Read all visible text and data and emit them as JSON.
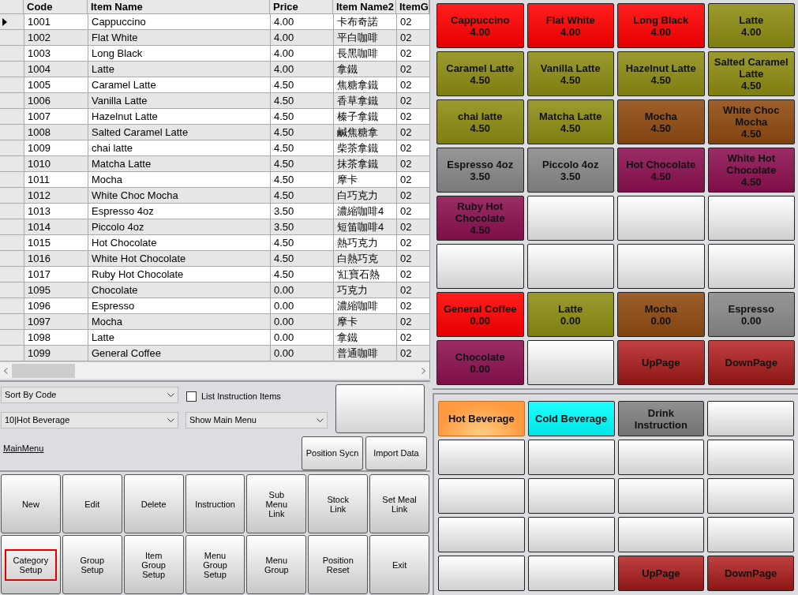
{
  "table": {
    "columns": [
      "Code",
      "Item Name",
      "Price",
      "Item Name2",
      "ItemG"
    ],
    "rows": [
      {
        "selected": true,
        "cells": [
          "1001",
          "Cappuccino",
          "4.00",
          "卡布奇諾",
          "02"
        ]
      },
      {
        "selected": false,
        "cells": [
          "1002",
          "Flat White",
          "4.00",
          "平白咖啡",
          "02"
        ]
      },
      {
        "selected": false,
        "cells": [
          "1003",
          "Long Black",
          "4.00",
          "長黑咖啡",
          "02"
        ]
      },
      {
        "selected": false,
        "cells": [
          "1004",
          "Latte",
          "4.00",
          "拿鐵",
          "02"
        ]
      },
      {
        "selected": false,
        "cells": [
          "1005",
          "Caramel Latte",
          "4.50",
          "焦糖拿鐵",
          "02"
        ]
      },
      {
        "selected": false,
        "cells": [
          "1006",
          "Vanilla Latte",
          "4.50",
          "香草拿鐵",
          "02"
        ]
      },
      {
        "selected": false,
        "cells": [
          "1007",
          "Hazelnut Latte",
          "4.50",
          "榛子拿鐵",
          "02"
        ]
      },
      {
        "selected": false,
        "cells": [
          "1008",
          "Salted Caramel Latte",
          "4.50",
          "鹹焦糖拿",
          "02"
        ]
      },
      {
        "selected": false,
        "cells": [
          "1009",
          "chai latte",
          "4.50",
          "柴茶拿鐵",
          "02"
        ]
      },
      {
        "selected": false,
        "cells": [
          "1010",
          "Matcha Latte",
          "4.50",
          "抹茶拿鐵",
          "02"
        ]
      },
      {
        "selected": false,
        "cells": [
          "1011",
          "Mocha",
          "4.50",
          "摩卡",
          "02"
        ]
      },
      {
        "selected": false,
        "cells": [
          "1012",
          "White Choc Mocha",
          "4.50",
          "白巧克力",
          "02"
        ]
      },
      {
        "selected": false,
        "cells": [
          "1013",
          "Espresso 4oz",
          "3.50",
          "濃縮咖啡4",
          "02"
        ]
      },
      {
        "selected": false,
        "cells": [
          "1014",
          "Piccolo 4oz",
          "3.50",
          "短笛咖啡4",
          "02"
        ]
      },
      {
        "selected": false,
        "cells": [
          "1015",
          "Hot Chocolate",
          "4.50",
          "熱巧克力",
          "02"
        ]
      },
      {
        "selected": false,
        "cells": [
          "1016",
          "White Hot Chocolate",
          "4.50",
          "白熱巧克",
          "02"
        ]
      },
      {
        "selected": false,
        "cells": [
          "1017",
          "Ruby Hot Chocolate",
          "4.50",
          "'紅寶石熱",
          "02"
        ]
      },
      {
        "selected": false,
        "cells": [
          "1095",
          "Chocolate",
          "0.00",
          "巧克力",
          "02"
        ]
      },
      {
        "selected": false,
        "cells": [
          "1096",
          "Espresso",
          "0.00",
          "濃縮咖啡",
          "02"
        ]
      },
      {
        "selected": false,
        "cells": [
          "1097",
          "Mocha",
          "0.00",
          "摩卡",
          "02"
        ]
      },
      {
        "selected": false,
        "cells": [
          "1098",
          "Latte",
          "0.00",
          "拿鐵",
          "02"
        ]
      },
      {
        "selected": false,
        "cells": [
          "1099",
          "General Coffee",
          "0.00",
          "普通咖啡",
          "02"
        ]
      }
    ]
  },
  "controls": {
    "sort_dropdown": "Sort By Code",
    "category_dropdown": "10|Hot Beverage",
    "list_instruction_items": {
      "label": "List Instruction Items",
      "checked": false
    },
    "menu_dropdown": "Show Main Menu",
    "link": "MainMenu",
    "buttons": [
      "Position Sycn",
      "Import Data"
    ]
  },
  "actions": [
    {
      "label": "New",
      "highlighted": false
    },
    {
      "label": "Edit",
      "highlighted": false
    },
    {
      "label": "Delete",
      "highlighted": false
    },
    {
      "label": "Instruction",
      "highlighted": false
    },
    {
      "label": "Sub Menu Link",
      "highlighted": false
    },
    {
      "label": "Stock Link",
      "highlighted": false
    },
    {
      "label": "Set Meal Link",
      "highlighted": false
    },
    {
      "label": "Category Setup",
      "highlighted": true
    },
    {
      "label": "Group Setup",
      "highlighted": false
    },
    {
      "label": "Item Group Setup",
      "highlighted": false
    },
    {
      "label": "Menu Group Setup",
      "highlighted": false
    },
    {
      "label": "Menu Group",
      "highlighted": false
    },
    {
      "label": "Position Reset",
      "highlighted": false
    },
    {
      "label": "Exit",
      "highlighted": false
    }
  ],
  "menu_buttons": [
    {
      "kind": "item",
      "label": "Cappuccino",
      "price": "4.00",
      "color": "#ff0000"
    },
    {
      "kind": "item",
      "label": "Flat White",
      "price": "4.00",
      "color": "#ff0000"
    },
    {
      "kind": "item",
      "label": "Long Black",
      "price": "4.00",
      "color": "#ff0000"
    },
    {
      "kind": "item",
      "label": "Latte",
      "price": "4.00",
      "color": "#8c8c12"
    },
    {
      "kind": "item",
      "label": "Caramel Latte",
      "price": "4.50",
      "color": "#8c8c12"
    },
    {
      "kind": "item",
      "label": "Vanilla Latte",
      "price": "4.50",
      "color": "#8c8c12"
    },
    {
      "kind": "item",
      "label": "Hazelnut Latte",
      "price": "4.50",
      "color": "#8c8c12"
    },
    {
      "kind": "item",
      "label": "Salted Caramel Latte",
      "price": "4.50",
      "color": "#8c8c12"
    },
    {
      "kind": "item",
      "label": "chai latte",
      "price": "4.50",
      "color": "#8c8c12"
    },
    {
      "kind": "item",
      "label": "Matcha Latte",
      "price": "4.50",
      "color": "#8c8c12"
    },
    {
      "kind": "item",
      "label": "Mocha",
      "price": "4.50",
      "color": "#8f4a10"
    },
    {
      "kind": "item",
      "label": "White Choc Mocha",
      "price": "4.50",
      "color": "#8f4a10"
    },
    {
      "kind": "item",
      "label": "Espresso 4oz",
      "price": "3.50",
      "color": "#888888"
    },
    {
      "kind": "item",
      "label": "Piccolo 4oz",
      "price": "3.50",
      "color": "#888888"
    },
    {
      "kind": "item",
      "label": "Hot Chocolate",
      "price": "4.50",
      "color": "#8c1050"
    },
    {
      "kind": "item",
      "label": "White Hot Chocolate",
      "price": "4.50",
      "color": "#8c1050"
    },
    {
      "kind": "item",
      "label": "Ruby Hot Chocolate",
      "price": "4.50",
      "color": "#8c1050"
    },
    {
      "kind": "empty"
    },
    {
      "kind": "empty"
    },
    {
      "kind": "empty"
    },
    {
      "kind": "empty"
    },
    {
      "kind": "empty"
    },
    {
      "kind": "empty"
    },
    {
      "kind": "empty"
    },
    {
      "kind": "item",
      "label": "General Coffee",
      "price": "0.00",
      "color": "#ff0000"
    },
    {
      "kind": "item",
      "label": "Latte",
      "price": "0.00",
      "color": "#8c8c12"
    },
    {
      "kind": "item",
      "label": "Mocha",
      "price": "0.00",
      "color": "#8f4a10"
    },
    {
      "kind": "item",
      "label": "Espresso",
      "price": "0.00",
      "color": "#888888"
    },
    {
      "kind": "item",
      "label": "Chocolate",
      "price": "0.00",
      "color": "#8c1050"
    },
    {
      "kind": "empty"
    },
    {
      "kind": "nav",
      "label": "UpPage"
    },
    {
      "kind": "nav",
      "label": "DownPage"
    }
  ],
  "category_buttons": [
    {
      "kind": "category",
      "label": "Hot Beverage",
      "color": "#ff9a40",
      "selected": true
    },
    {
      "kind": "category",
      "label": "Cold Beverage",
      "color": "#00ffff",
      "selected": false
    },
    {
      "kind": "category",
      "label": "Drink Instruction",
      "color": "#808080",
      "selected": false
    },
    {
      "kind": "empty"
    },
    {
      "kind": "empty"
    },
    {
      "kind": "empty"
    },
    {
      "kind": "empty"
    },
    {
      "kind": "empty"
    },
    {
      "kind": "empty"
    },
    {
      "kind": "empty"
    },
    {
      "kind": "empty"
    },
    {
      "kind": "empty"
    },
    {
      "kind": "empty"
    },
    {
      "kind": "empty"
    },
    {
      "kind": "empty"
    },
    {
      "kind": "empty"
    },
    {
      "kind": "empty"
    },
    {
      "kind": "empty"
    },
    {
      "kind": "nav",
      "label": "UpPage"
    },
    {
      "kind": "nav",
      "label": "DownPage"
    }
  ]
}
